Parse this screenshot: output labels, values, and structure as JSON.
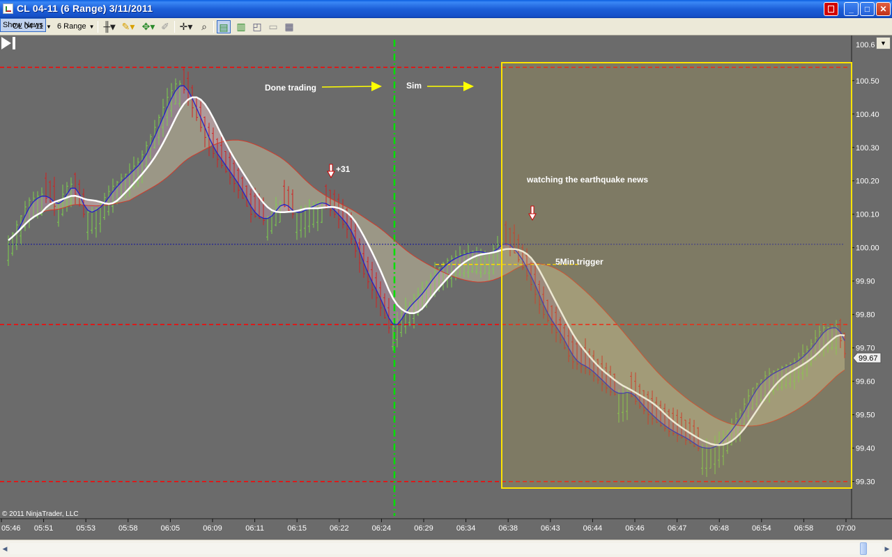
{
  "window": {
    "title": "CL 04-11 (6 Range)  3/11/2011",
    "buttons": {
      "link": "L",
      "minimize": "_",
      "maximize": "□",
      "close": "✕"
    }
  },
  "toolbar": {
    "instrument": "CL 04-11",
    "bar_type": "6 Range",
    "show_news_label": "Show News",
    "icons": [
      "bar-style-icon",
      "drawing-pencil-icon",
      "drawing-tools-icon",
      "eraser-icon",
      "crosshair-icon",
      "zoom-icon",
      "chart-trader-icon",
      "candlestick-icon",
      "line-chart-icon",
      "data-box-icon",
      "properties-icon"
    ]
  },
  "chart": {
    "copyright": "© 2011 NinjaTrader, LLC",
    "last_price_label": "99.67",
    "colors": {
      "background": "#6b6b6b",
      "up_bar": "#7cd04e",
      "down_bar": "#d22020",
      "sma_fast": "#2020c8",
      "sma_slow": "#ffffff",
      "sim_box": "#ffe400",
      "marker_line": "#ff0000",
      "session_line": "#00e000"
    },
    "annotations": {
      "done_trading": "Done trading",
      "sim": "Sim",
      "plus31": "+31",
      "watching": "watching the earthquake news",
      "trigger": "5Min trigger"
    }
  },
  "chart_data": {
    "type": "bar",
    "instrument": "CL 04-11",
    "y_ticks": [
      "100.50",
      "100.40",
      "100.30",
      "100.20",
      "100.10",
      "100.00",
      "99.90",
      "99.80",
      "99.70",
      "99.60",
      "99.50",
      "99.40",
      "99.30"
    ],
    "y_range": [
      99.27,
      100.61
    ],
    "x_ticks": [
      "05:46",
      "05:51",
      "05:53",
      "05:58",
      "06:05",
      "06:09",
      "06:11",
      "06:15",
      "06:22",
      "06:24",
      "06:29",
      "06:34",
      "06:38",
      "06:43",
      "06:44",
      "06:46",
      "06:47",
      "06:48",
      "06:54",
      "06:58",
      "07:00"
    ],
    "last_price": 99.67,
    "horizontal_lines": [
      100.54,
      99.77,
      99.3,
      100.01
    ],
    "trigger_level": 99.95,
    "close_path": [
      [
        0,
        99.98
      ],
      [
        20,
        100.05
      ],
      [
        40,
        100.14
      ],
      [
        60,
        100.16
      ],
      [
        80,
        100.12
      ],
      [
        100,
        100.2
      ],
      [
        120,
        100.1
      ],
      [
        140,
        100.12
      ],
      [
        160,
        100.18
      ],
      [
        180,
        100.22
      ],
      [
        200,
        100.26
      ],
      [
        220,
        100.35
      ],
      [
        240,
        100.45
      ],
      [
        255,
        100.5
      ],
      [
        265,
        100.47
      ],
      [
        280,
        100.4
      ],
      [
        300,
        100.3
      ],
      [
        320,
        100.24
      ],
      [
        340,
        100.18
      ],
      [
        360,
        100.1
      ],
      [
        380,
        100.08
      ],
      [
        400,
        100.14
      ],
      [
        420,
        100.1
      ],
      [
        440,
        100.12
      ],
      [
        460,
        100.14
      ],
      [
        480,
        100.1
      ],
      [
        500,
        100.05
      ],
      [
        520,
        99.93
      ],
      [
        540,
        99.85
      ],
      [
        560,
        99.75
      ],
      [
        580,
        99.82
      ],
      [
        600,
        99.86
      ],
      [
        620,
        99.92
      ],
      [
        640,
        99.96
      ],
      [
        660,
        99.98
      ],
      [
        680,
        99.99
      ],
      [
        700,
        99.98
      ],
      [
        720,
        100.02
      ],
      [
        740,
        99.98
      ],
      [
        760,
        99.9
      ],
      [
        780,
        99.8
      ],
      [
        800,
        99.74
      ],
      [
        820,
        99.66
      ],
      [
        840,
        99.64
      ],
      [
        860,
        99.6
      ],
      [
        880,
        99.56
      ],
      [
        900,
        99.57
      ],
      [
        920,
        99.52
      ],
      [
        940,
        99.48
      ],
      [
        960,
        99.45
      ],
      [
        980,
        99.43
      ],
      [
        1000,
        99.4
      ],
      [
        1020,
        99.4
      ],
      [
        1040,
        99.44
      ],
      [
        1060,
        99.5
      ],
      [
        1080,
        99.58
      ],
      [
        1100,
        99.62
      ],
      [
        1120,
        99.64
      ],
      [
        1140,
        99.66
      ],
      [
        1160,
        99.7
      ],
      [
        1180,
        99.76
      ],
      [
        1200,
        99.76
      ],
      [
        1214,
        99.67
      ]
    ]
  }
}
